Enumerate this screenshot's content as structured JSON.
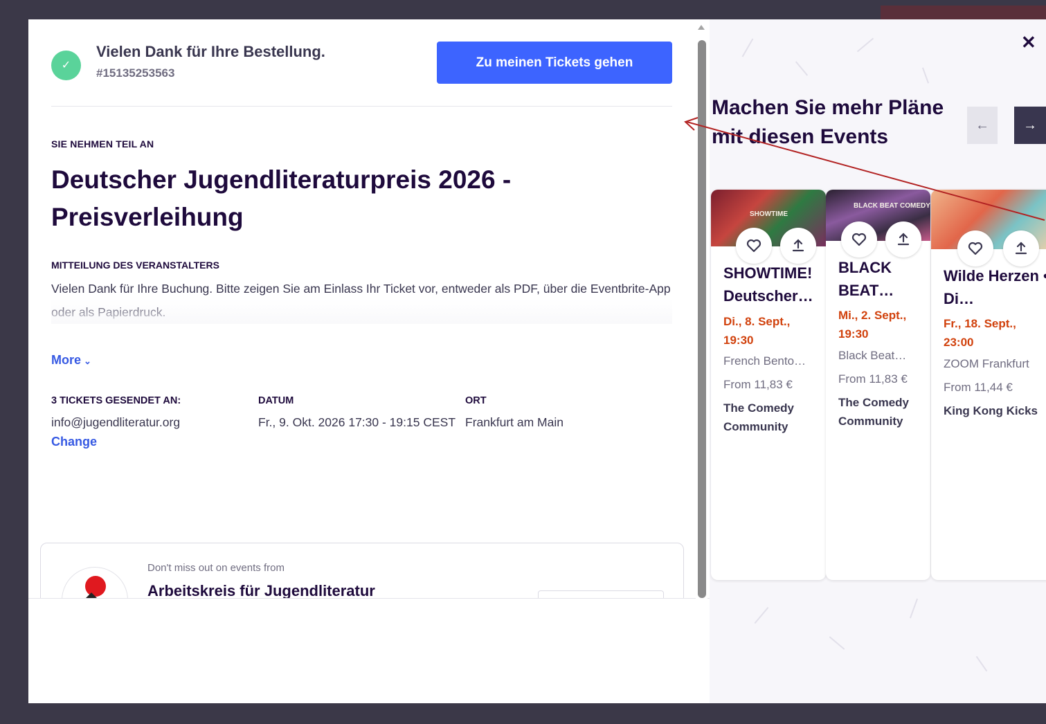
{
  "confirmation": {
    "thanks": "Vielen Dank für Ihre Bestellung.",
    "order_number": "#15135253563",
    "tickets_button": "Zu meinen Tickets gehen"
  },
  "event": {
    "attending_label": "SIE NEHMEN TEIL AN",
    "title": "Deutscher Jugendliteraturpreis 2026 - Preisverleihung",
    "organizer_message_label": "MITTEILUNG DES VERANSTALTERS",
    "organizer_message": "Vielen Dank für Ihre Buchung. Bitte zeigen Sie am Einlass Ihr Ticket vor, entweder als PDF, über die Eventbrite-App oder als Papierdruck.",
    "more_link": "More"
  },
  "details": {
    "sent_to_label": "3 TICKETS GESENDET AN:",
    "sent_to_value": "info@jugendliteratur.org",
    "change_link": "Change",
    "date_label": "DATUM",
    "date_value": "Fr., 9. Okt. 2026 17:30 - 19:15 CEST",
    "location_label": "ORT",
    "location_value": "Frankfurt am Main"
  },
  "organizer_card": {
    "dont_miss": "Don't miss out on events from",
    "name": "Arbeitskreis für Jugendliteratur"
  },
  "recommendations": {
    "heading": "Machen Sie mehr Pläne mit diesen Events",
    "cards": [
      {
        "image_label": "SHOWTIME",
        "title": "SHOWTIME! Deutscher…",
        "date": "Di., 8. Sept., 19:30",
        "venue": "French Bento…",
        "price": "From 11,83 €",
        "organizer": "The Comedy Community"
      },
      {
        "image_label": "BLACK BEAT COMEDY",
        "title": "BLACK BEAT…",
        "date": "Mi., 2. Sept., 19:30",
        "venue": "Black Beat…",
        "price": "From 11,83 €",
        "organizer": "The Comedy Community"
      },
      {
        "image_label": "",
        "title": "Wilde Herzen • Di…",
        "date": "Fr., 18. Sept., 23:00",
        "venue": "ZOOM Frankfurt",
        "price": "From 11,44 €",
        "organizer": "King Kong Kicks"
      }
    ]
  },
  "colors": {
    "accent_blue": "#3d64ff",
    "link_blue": "#3659e3",
    "date_orange": "#d1410c",
    "success_green": "#5ad39a",
    "annotation_red": "#b22222"
  },
  "icons": [
    "check-icon",
    "close-icon",
    "arrow-left-icon",
    "arrow-right-icon",
    "heart-icon",
    "share-icon",
    "chevron-down-icon"
  ]
}
